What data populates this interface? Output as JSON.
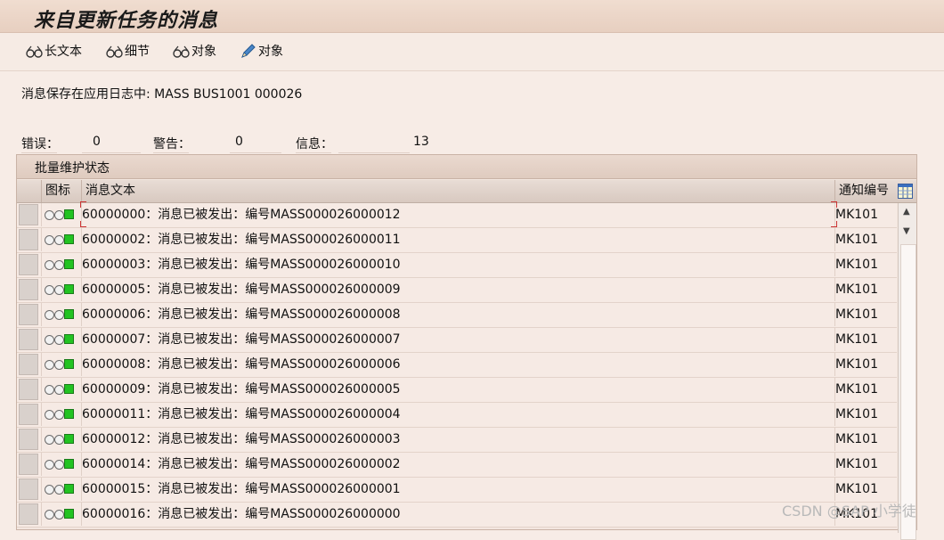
{
  "window": {
    "title": "来自更新任务的消息"
  },
  "toolbar": {
    "buttons": [
      {
        "label": "长文本",
        "icon": "glasses-icon"
      },
      {
        "label": "细节",
        "icon": "glasses-icon"
      },
      {
        "label": "对象",
        "icon": "glasses-icon"
      },
      {
        "label": "对象",
        "icon": "pencil-icon"
      }
    ]
  },
  "log_info": "消息保存在应用日志中: MASS BUS1001 000026",
  "counts": {
    "errors_label": "错误：",
    "errors_value": "0",
    "warnings_label": "警告：",
    "warnings_value": "0",
    "info_label": "信息：",
    "info_value": "13"
  },
  "panel": {
    "title": "批量维护状态",
    "columns": {
      "icon": "图标",
      "text": "消息文本",
      "number": "通知编号"
    },
    "rows": [
      {
        "text": "60000000：消息已被发出：编号MASS000026000012",
        "number": "MK101",
        "status": "green"
      },
      {
        "text": "60000002：消息已被发出：编号MASS000026000011",
        "number": "MK101",
        "status": "green"
      },
      {
        "text": "60000003：消息已被发出：编号MASS000026000010",
        "number": "MK101",
        "status": "green"
      },
      {
        "text": "60000005：消息已被发出：编号MASS000026000009",
        "number": "MK101",
        "status": "green"
      },
      {
        "text": "60000006：消息已被发出：编号MASS000026000008",
        "number": "MK101",
        "status": "green"
      },
      {
        "text": "60000007：消息已被发出：编号MASS000026000007",
        "number": "MK101",
        "status": "green"
      },
      {
        "text": "60000008：消息已被发出：编号MASS000026000006",
        "number": "MK101",
        "status": "green"
      },
      {
        "text": "60000009：消息已被发出：编号MASS000026000005",
        "number": "MK101",
        "status": "green"
      },
      {
        "text": "60000011：消息已被发出：编号MASS000026000004",
        "number": "MK101",
        "status": "green"
      },
      {
        "text": "60000012：消息已被发出：编号MASS000026000003",
        "number": "MK101",
        "status": "green"
      },
      {
        "text": "60000014：消息已被发出：编号MASS000026000002",
        "number": "MK101",
        "status": "green"
      },
      {
        "text": "60000015：消息已被发出：编号MASS000026000001",
        "number": "MK101",
        "status": "green"
      },
      {
        "text": "60000016：消息已被发出：编号MASS000026000000",
        "number": "MK101",
        "status": "green"
      }
    ]
  },
  "watermark": "CSDN @SAP 小学徒",
  "colors": {
    "accent": "#22c322",
    "background": "#f7ece6"
  }
}
